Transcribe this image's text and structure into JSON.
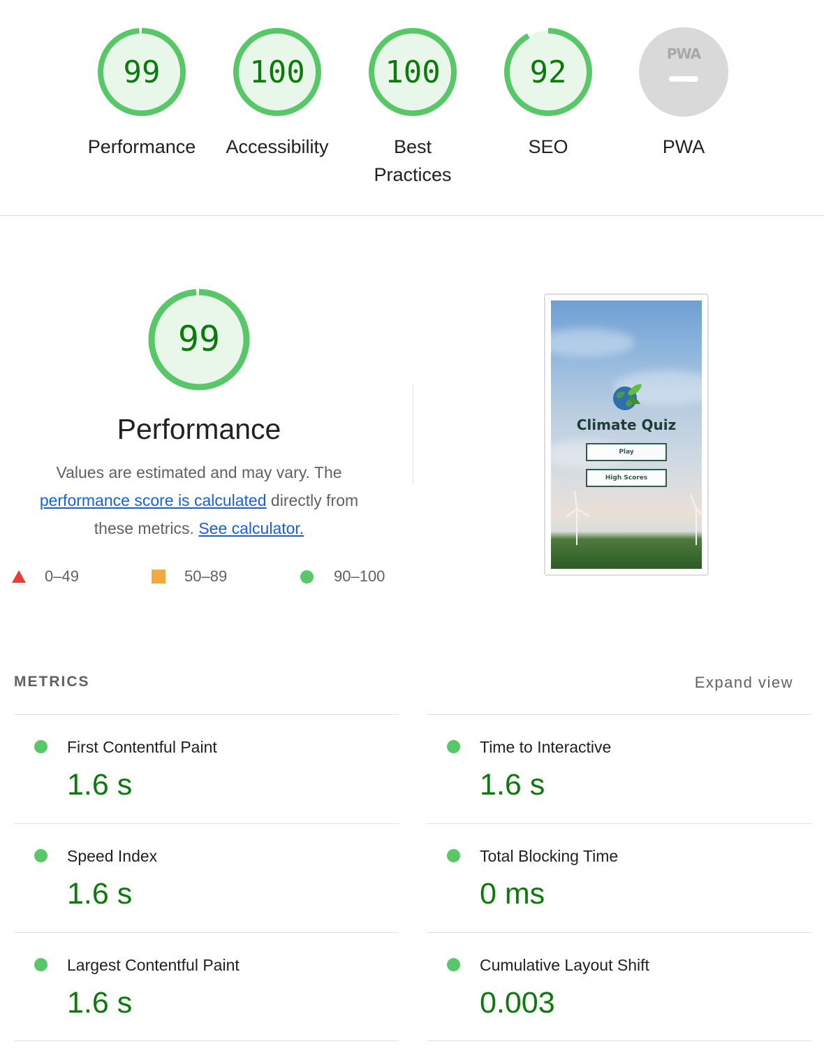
{
  "colors": {
    "pass": "#0b7a0b",
    "pass_ring": "#58c768",
    "pass_fill": "#e8f7ea",
    "average": "#f4a93e",
    "fail": "#eb3c36",
    "neutral": "#d9d9d9",
    "link": "#1a5fd6"
  },
  "categories": [
    {
      "label": "Performance",
      "score": "99",
      "value": 0.99
    },
    {
      "label": "Accessibility",
      "score": "100",
      "value": 1.0
    },
    {
      "label": "Best Practices",
      "score": "100",
      "value": 1.0
    },
    {
      "label": "SEO",
      "score": "92",
      "value": 0.92
    },
    {
      "label": "PWA",
      "score": "",
      "icon": "pwa-badge-icon",
      "badge_text": "PWA"
    }
  ],
  "summary": {
    "score": "99",
    "value": 0.99,
    "title": "Performance",
    "desc_before": "Values are estimated and may vary. The ",
    "desc_link": "performance score is calculated",
    "desc_middle": " directly from these metrics. ",
    "calc_link": "See calculator."
  },
  "legend": [
    {
      "range": "0–49",
      "icon": "fail-triangle-icon"
    },
    {
      "range": "50–89",
      "icon": "average-square-icon"
    },
    {
      "range": "90–100",
      "icon": "pass-circle-icon"
    }
  ],
  "screenshot": {
    "app_title": "Climate Quiz",
    "play_label": "Play",
    "high_scores_label": "High Scores"
  },
  "metrics_header": "METRICS",
  "expand_view": "Expand view",
  "metrics_left": [
    {
      "name": "First Contentful Paint",
      "value": "1.6 s"
    },
    {
      "name": "Speed Index",
      "value": "1.6 s"
    },
    {
      "name": "Largest Contentful Paint",
      "value": "1.6 s"
    }
  ],
  "metrics_right": [
    {
      "name": "Time to Interactive",
      "value": "1.6 s"
    },
    {
      "name": "Total Blocking Time",
      "value": "0 ms"
    },
    {
      "name": "Cumulative Layout Shift",
      "value": "0.003"
    }
  ]
}
